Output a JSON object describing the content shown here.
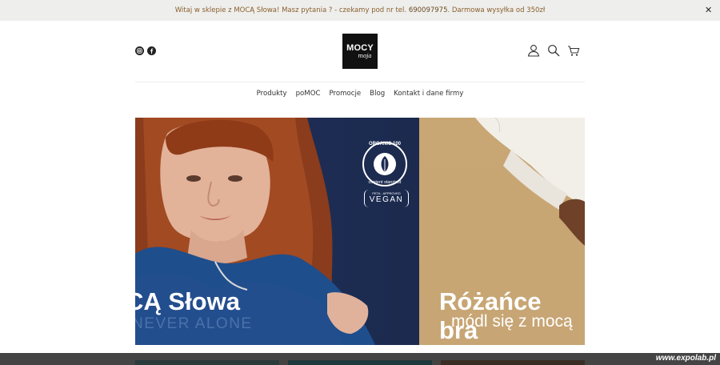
{
  "announcement": {
    "text_before": "Witaj w sklepie z MOCĄ Słowa! Masz pytania ? - czekamy pod nr tel. ",
    "phone": "690097975",
    "text_after": ". Darmowa wysyłka od 350zł",
    "close_icon": "close-icon"
  },
  "social": [
    {
      "name": "instagram-icon"
    },
    {
      "name": "facebook-icon"
    }
  ],
  "logo": {
    "line1": "MOCY",
    "line2": "moja"
  },
  "header_icons": [
    "user-icon",
    "search-icon",
    "cart-icon"
  ],
  "nav": {
    "items": [
      {
        "label": "Produkty"
      },
      {
        "label": "poMOC"
      },
      {
        "label": "Promocje"
      },
      {
        "label": "Blog"
      },
      {
        "label": "Kontakt i dane firmy"
      }
    ]
  },
  "hero": {
    "slide1": {
      "title": "CĄ Słowa",
      "shirt_text": "NEVER ALONE",
      "badge_organic": "ORGANIC 100",
      "badge_standard": "content standard",
      "vegan_top": "PETA - APPROVED",
      "vegan": "VEGAN"
    },
    "slide2": {
      "title": "Różańce bra",
      "subtitle": "módl się z mocą"
    }
  },
  "footer": {
    "watermark": "www.expolab.pl"
  },
  "colors": {
    "topbar_bg": "#eeeeec",
    "topbar_text": "#8a5f2d",
    "hero_navy": "#1d2b52",
    "hero_tan": "#c8a774",
    "strip": "#444444"
  }
}
